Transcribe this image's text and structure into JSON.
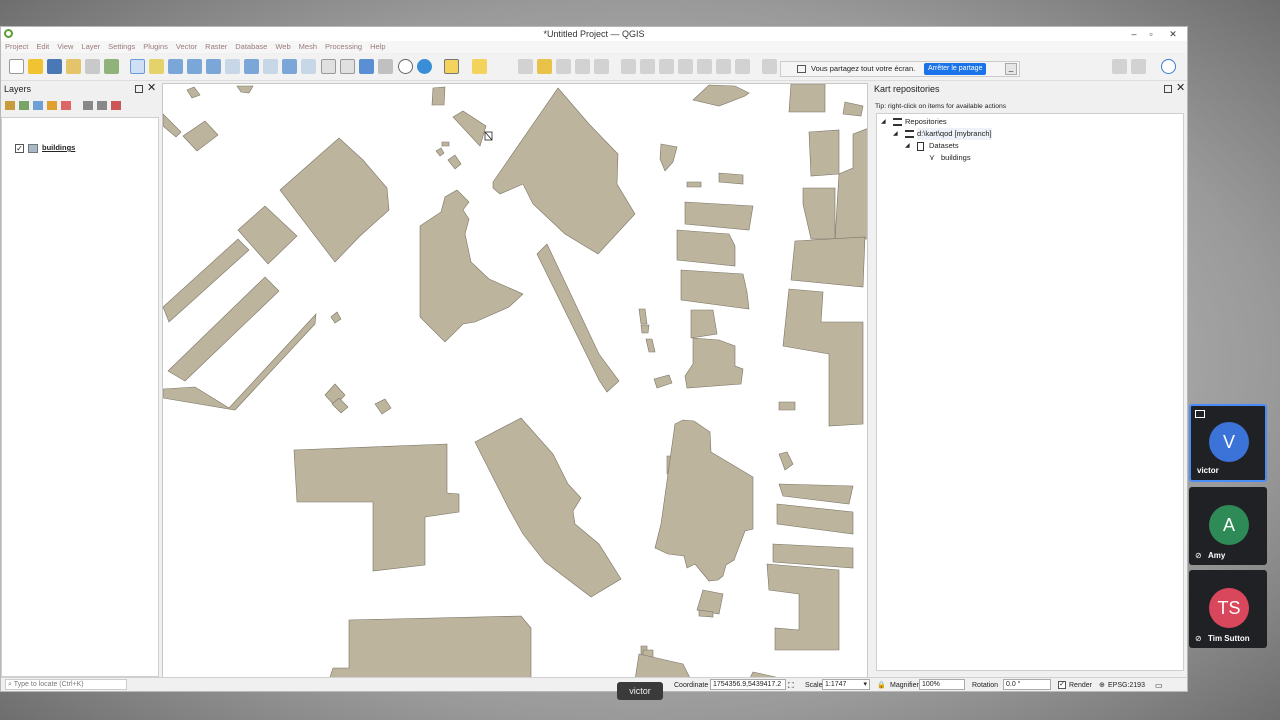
{
  "window": {
    "title": "*Untitled Project — QGIS",
    "controls": [
      "–",
      "▫",
      "✕"
    ]
  },
  "menubar": [
    "Project",
    "Edit",
    "View",
    "Layer",
    "Settings",
    "Plugins",
    "Vector",
    "Raster",
    "Database",
    "Web",
    "Mesh",
    "Processing",
    "Help"
  ],
  "share_banner": {
    "message": "Vous partagez tout votre écran.",
    "stop_label": "Arrêter le partage",
    "minimize_label": "_"
  },
  "layers_panel": {
    "title": "Layers",
    "layers": [
      {
        "name": "buildings",
        "checked": true
      }
    ]
  },
  "kart_panel": {
    "title": "Kart repositories",
    "tip": "Tip: right-click on items for available actions",
    "tree": {
      "root": "Repositories",
      "repo": "d:\\kart\\qod [mybranch]",
      "datasets_label": "Datasets",
      "dataset": "buildings"
    }
  },
  "statusbar": {
    "locate_placeholder": "Type to locate (Ctrl+K)",
    "coordinate_label": "Coordinate",
    "coordinate_value": "1754356.9,5439417.2",
    "scale_label": "Scale",
    "scale_value": "1:1747",
    "magnifier_label": "Magnifier",
    "magnifier_value": "100%",
    "rotation_label": "Rotation",
    "rotation_value": "0.0 °",
    "render_label": "Render",
    "crs": "EPSG:2193"
  },
  "participants": [
    {
      "initials": "V",
      "name": "victor",
      "color": "#3b73d8"
    },
    {
      "initials": "A",
      "name": "Amy",
      "color": "#2e8b57"
    },
    {
      "initials": "TS",
      "name": "Tim Sutton",
      "color": "#d9475c"
    }
  ],
  "presenter_tag": "victor",
  "colors": {
    "building_fill": "#bdb49d",
    "building_stroke": "#7a7466"
  }
}
